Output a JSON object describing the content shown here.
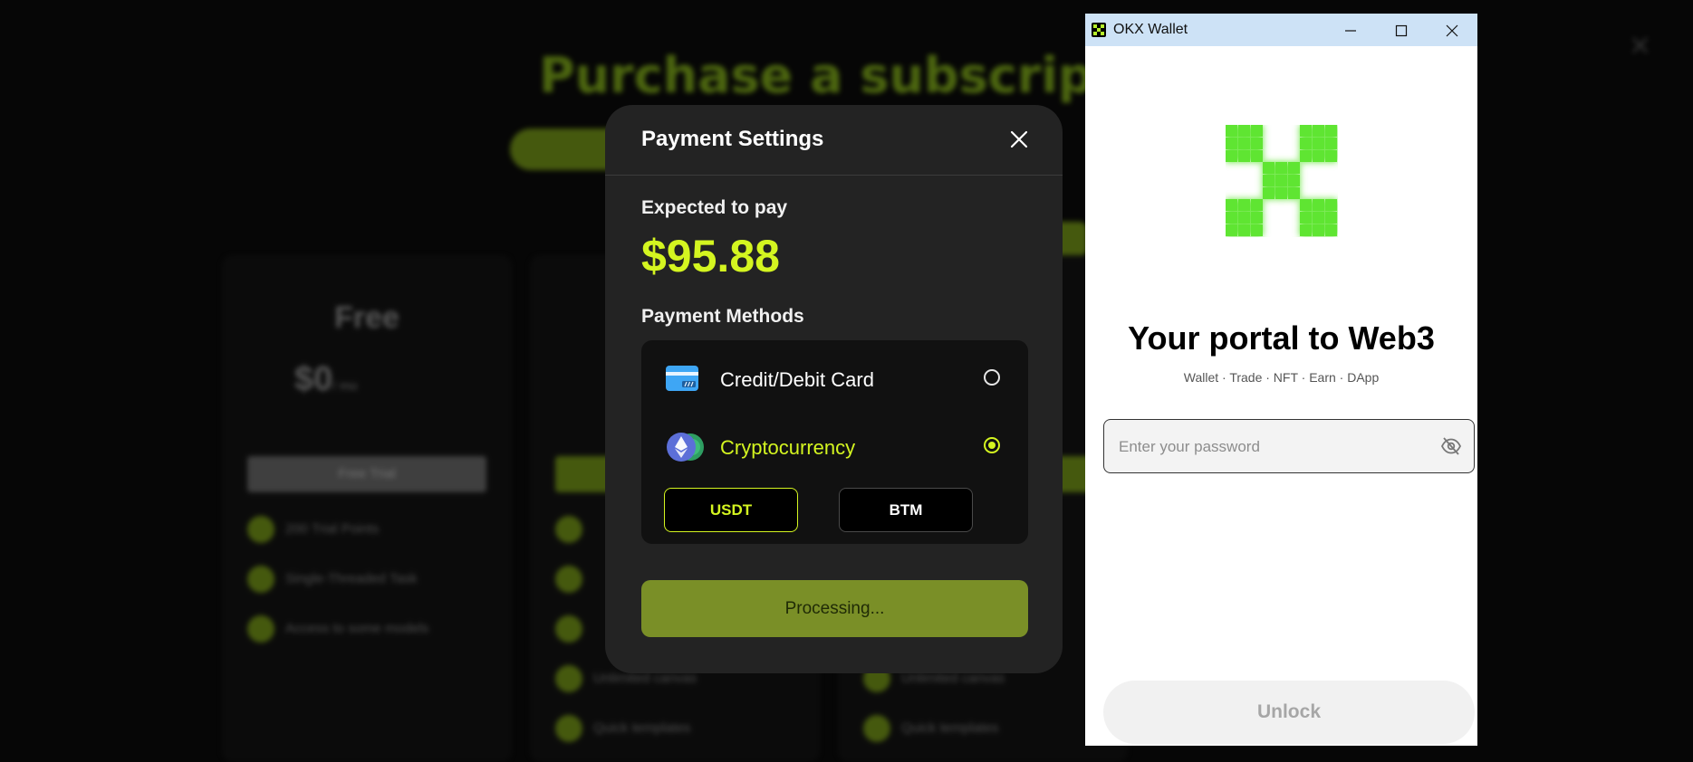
{
  "background": {
    "title": "Purchase a subscription",
    "plans": [
      {
        "name": "Free",
        "price": "$0",
        "period": "/ mo",
        "button": "Free Trial",
        "features": [
          "200 Trial Points",
          "Single-Threaded Task",
          "Access to some models"
        ]
      },
      {
        "name": "",
        "price": "",
        "period": "",
        "button": "",
        "features": [
          "",
          "",
          "",
          "Unlimited canvas",
          "Quick templates"
        ]
      },
      {
        "name": "",
        "price": "",
        "period": "",
        "button": "",
        "features": [
          "",
          "",
          "",
          "Unlimited canvas",
          "Quick templates"
        ]
      }
    ]
  },
  "modal": {
    "title": "Payment Settings",
    "expected_label": "Expected to pay",
    "amount": "$95.88",
    "methods_label": "Payment Methods",
    "methods": [
      {
        "label": "Credit/Debit Card",
        "icon": "credit-card-icon",
        "selected": false
      },
      {
        "label": "Cryptocurrency",
        "icon": "ethereum-icon",
        "selected": true
      }
    ],
    "currencies": [
      "USDT",
      "BTM"
    ],
    "selected_currency": "USDT",
    "submit_label": "Processing..."
  },
  "wallet": {
    "window_title": "OKX Wallet",
    "headline": "Your portal to Web3",
    "tagline": "Wallet · Trade · NFT · Earn · DApp",
    "password_placeholder": "Enter your password",
    "unlock_label": "Unlock"
  },
  "colors": {
    "accent": "#d4f520",
    "processing": "#7a8f27",
    "okx_green": "#5ee530",
    "titlebar": "#cde2f6"
  }
}
